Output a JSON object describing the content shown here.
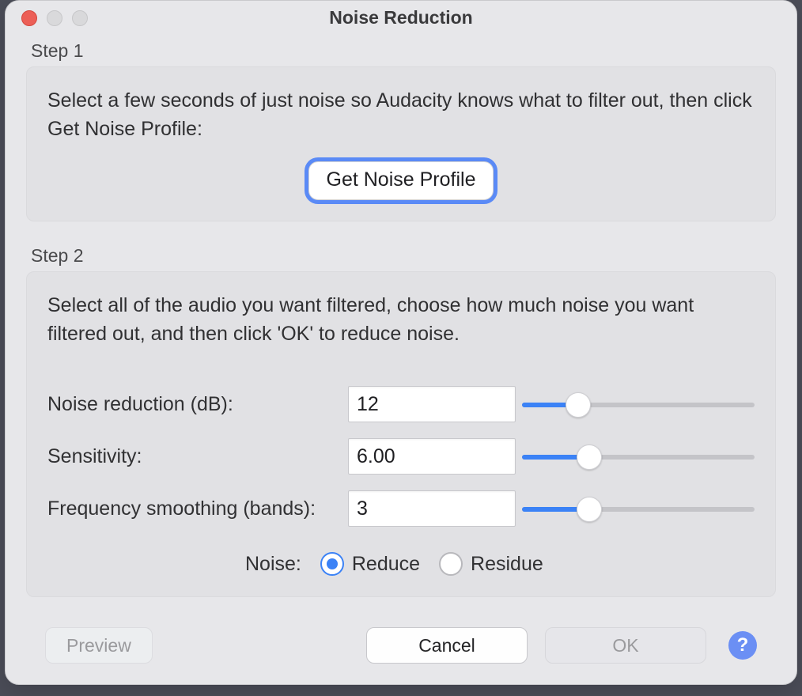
{
  "dialog": {
    "title": "Noise Reduction"
  },
  "step1": {
    "label": "Step 1",
    "desc": "Select a few seconds of just noise so Audacity knows what to filter out, then click Get Noise Profile:",
    "button_label": "Get Noise Profile"
  },
  "step2": {
    "label": "Step 2",
    "desc": "Select all of the audio you want filtered, choose how much noise you want filtered out, and then click 'OK' to reduce noise.",
    "controls": {
      "noise_reduction": {
        "label": "Noise reduction (dB):",
        "value": "12",
        "slider_pct": 24
      },
      "sensitivity": {
        "label": "Sensitivity:",
        "value": "6.00",
        "slider_pct": 29
      },
      "freq_smoothing": {
        "label": "Frequency smoothing (bands):",
        "value": "3",
        "slider_pct": 29
      }
    },
    "noise_mode": {
      "label": "Noise:",
      "options": [
        "Reduce",
        "Residue"
      ],
      "selected": "Reduce"
    }
  },
  "footer": {
    "preview_label": "Preview",
    "cancel_label": "Cancel",
    "ok_label": "OK",
    "help_glyph": "?"
  },
  "colors": {
    "accent": "#3b82f6"
  }
}
